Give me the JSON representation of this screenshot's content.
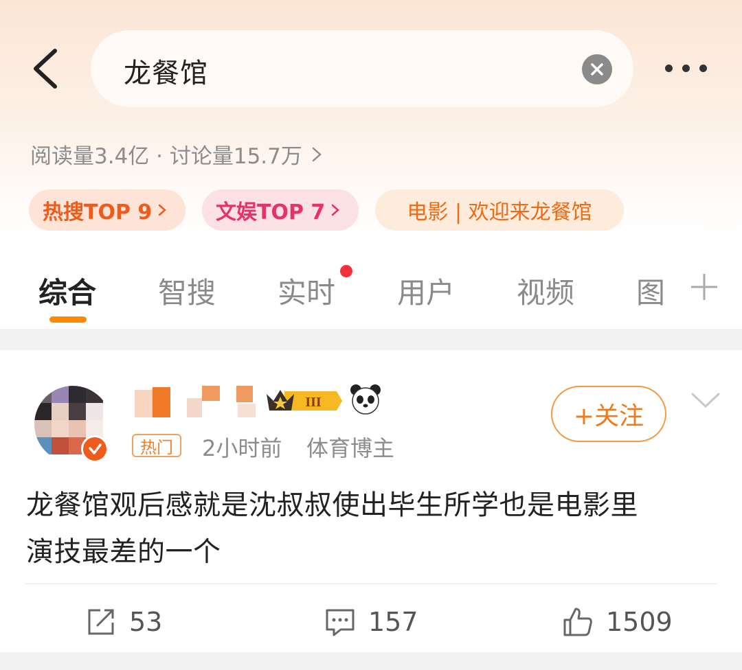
{
  "search": {
    "query": "龙餐馆"
  },
  "topic_stats": {
    "text": "阅读量3.4亿 · 讨论量15.7万"
  },
  "tags": [
    {
      "label": "热搜TOP 9"
    },
    {
      "label": "文娱TOP 7"
    },
    {
      "label": "电影 | 欢迎来龙餐馆"
    }
  ],
  "tabs": [
    {
      "label": "综合"
    },
    {
      "label": "智搜"
    },
    {
      "label": "实时"
    },
    {
      "label": "用户"
    },
    {
      "label": "视频"
    },
    {
      "label": "图"
    }
  ],
  "post": {
    "badge_level": "III",
    "hot_label": "热门",
    "time": "2小时前",
    "author_type": "体育博主",
    "follow_label": "+关注",
    "content_line1": "龙餐馆观后感就是沈叔叔使出毕生所学也是电影里",
    "content_line2": "演技最差的一个",
    "actions": {
      "repost": "53",
      "comment": "157",
      "like": "1509"
    }
  },
  "colors": {
    "accent": "#ff8a00",
    "hot_tag": "#f05a1c",
    "ent_tag": "#e8306a",
    "notify_dot": "#f2313a"
  }
}
